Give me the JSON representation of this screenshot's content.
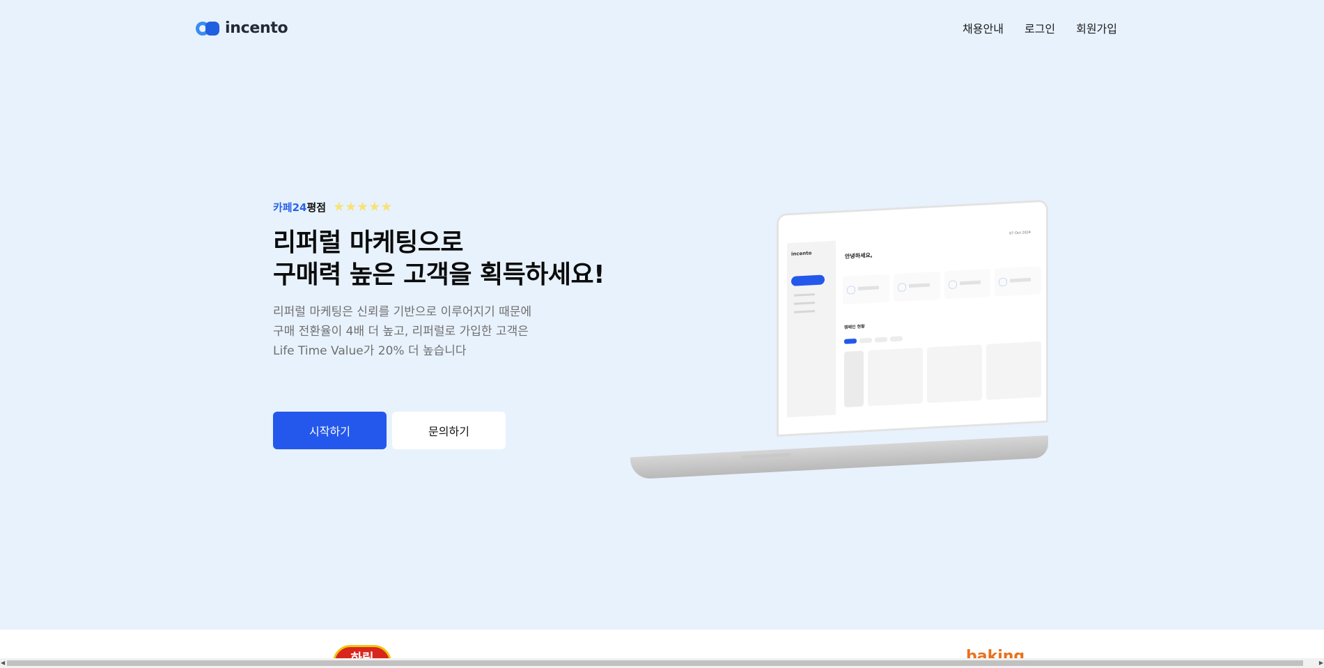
{
  "header": {
    "logo_text": "incento",
    "nav": [
      {
        "label": "채용안내"
      },
      {
        "label": "로그인"
      },
      {
        "label": "회원가입"
      }
    ]
  },
  "hero": {
    "rating_brand": "카페24",
    "rating_label": "평점",
    "stars": "★★★★★",
    "star_count": 5,
    "headline_line1": "리퍼럴 마케팅으로",
    "headline_line2": "구매력 높은 고객을 획득하세요!",
    "desc_line1": "리퍼럴 마케팅은 신뢰를 기반으로 이루어지기 때문에",
    "desc_line2": "구매 전환율이 4배 더 높고, 리퍼럴로 가입한 고객은",
    "desc_line3": "Life Time Value가 20% 더 높습니다",
    "primary_button": "시작하기",
    "secondary_button": "문의하기"
  },
  "dashboard_preview": {
    "logo": "incento",
    "title": "안녕하세요,",
    "date": "07 Oct 2024",
    "section": "캠페인 현황"
  },
  "partner_logos": {
    "badge": "하림",
    "wordmark1": "",
    "wordmark2": "",
    "baking": "baking"
  },
  "colors": {
    "background": "#e8f2fd",
    "primary": "#2458ec",
    "brand_text": "#2a63e6",
    "star": "#f7e27a"
  }
}
